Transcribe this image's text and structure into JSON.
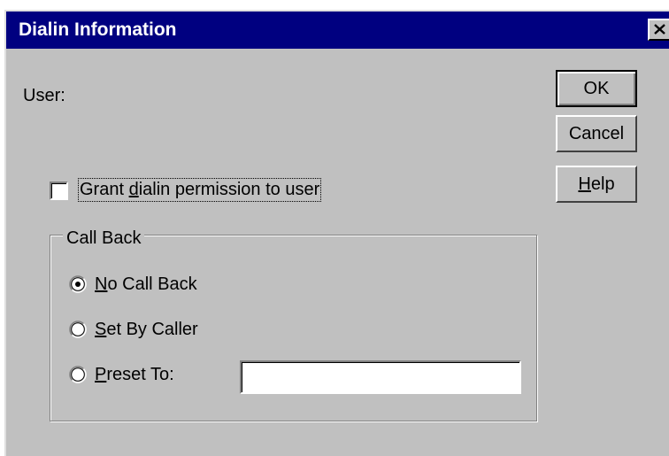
{
  "window": {
    "title": "Dialin Information",
    "close_icon": "close-x-icon"
  },
  "user": {
    "label": "User:"
  },
  "buttons": {
    "ok": "OK",
    "cancel": "Cancel",
    "help_prefix": "",
    "help_mnemonic": "H",
    "help_rest": "elp"
  },
  "grant_permission": {
    "label_before": "Grant ",
    "label_mnemonic": "d",
    "label_after": "ialin permission to user",
    "checked": false
  },
  "call_back": {
    "group_label": "Call Back",
    "options": [
      {
        "mnemonic": "N",
        "rest": "o Call Back",
        "selected": true
      },
      {
        "mnemonic": "S",
        "rest": "et By Caller",
        "selected": false
      },
      {
        "mnemonic": "P",
        "rest": "reset To:",
        "selected": false
      }
    ],
    "preset_value": ""
  },
  "colors": {
    "titlebar": "#000080",
    "face": "#c0c0c0",
    "title_text": "#ffffff"
  }
}
